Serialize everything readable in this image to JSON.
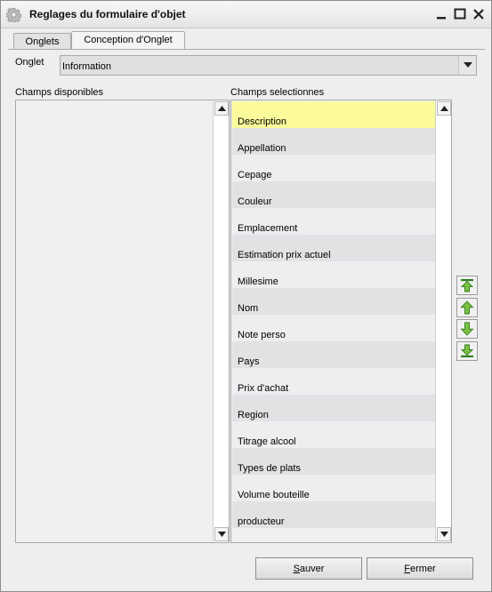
{
  "window": {
    "title": "Reglages du formulaire d'objet",
    "app_icon": "gear-icon"
  },
  "tabs": [
    {
      "label": "Onglets"
    },
    {
      "label": "Conception d'Onglet",
      "active": true
    }
  ],
  "onglet": {
    "label": "Onglet",
    "value": "Information"
  },
  "available": {
    "label": "Champs disponibles",
    "items": []
  },
  "selected": {
    "label": "Champs selectionnes",
    "items": [
      "Description",
      "Appellation",
      "Cepage",
      "Couleur",
      "Emplacement",
      "Estimation prix actuel",
      "Millesime",
      "Nom",
      "Note perso",
      "Pays",
      "Prix d'achat",
      "Region",
      "Titrage alcool",
      "Types de plats",
      "Volume bouteille",
      "producteur"
    ],
    "highlighted": "Description",
    "highlight_color": "#fcfb9c"
  },
  "move_buttons": [
    "move-to-top-icon",
    "move-up-icon",
    "move-down-icon",
    "move-to-bottom-icon"
  ],
  "arrow_color": "#7ac143",
  "buttons": {
    "save": "Sauver",
    "close": "Fermer"
  }
}
